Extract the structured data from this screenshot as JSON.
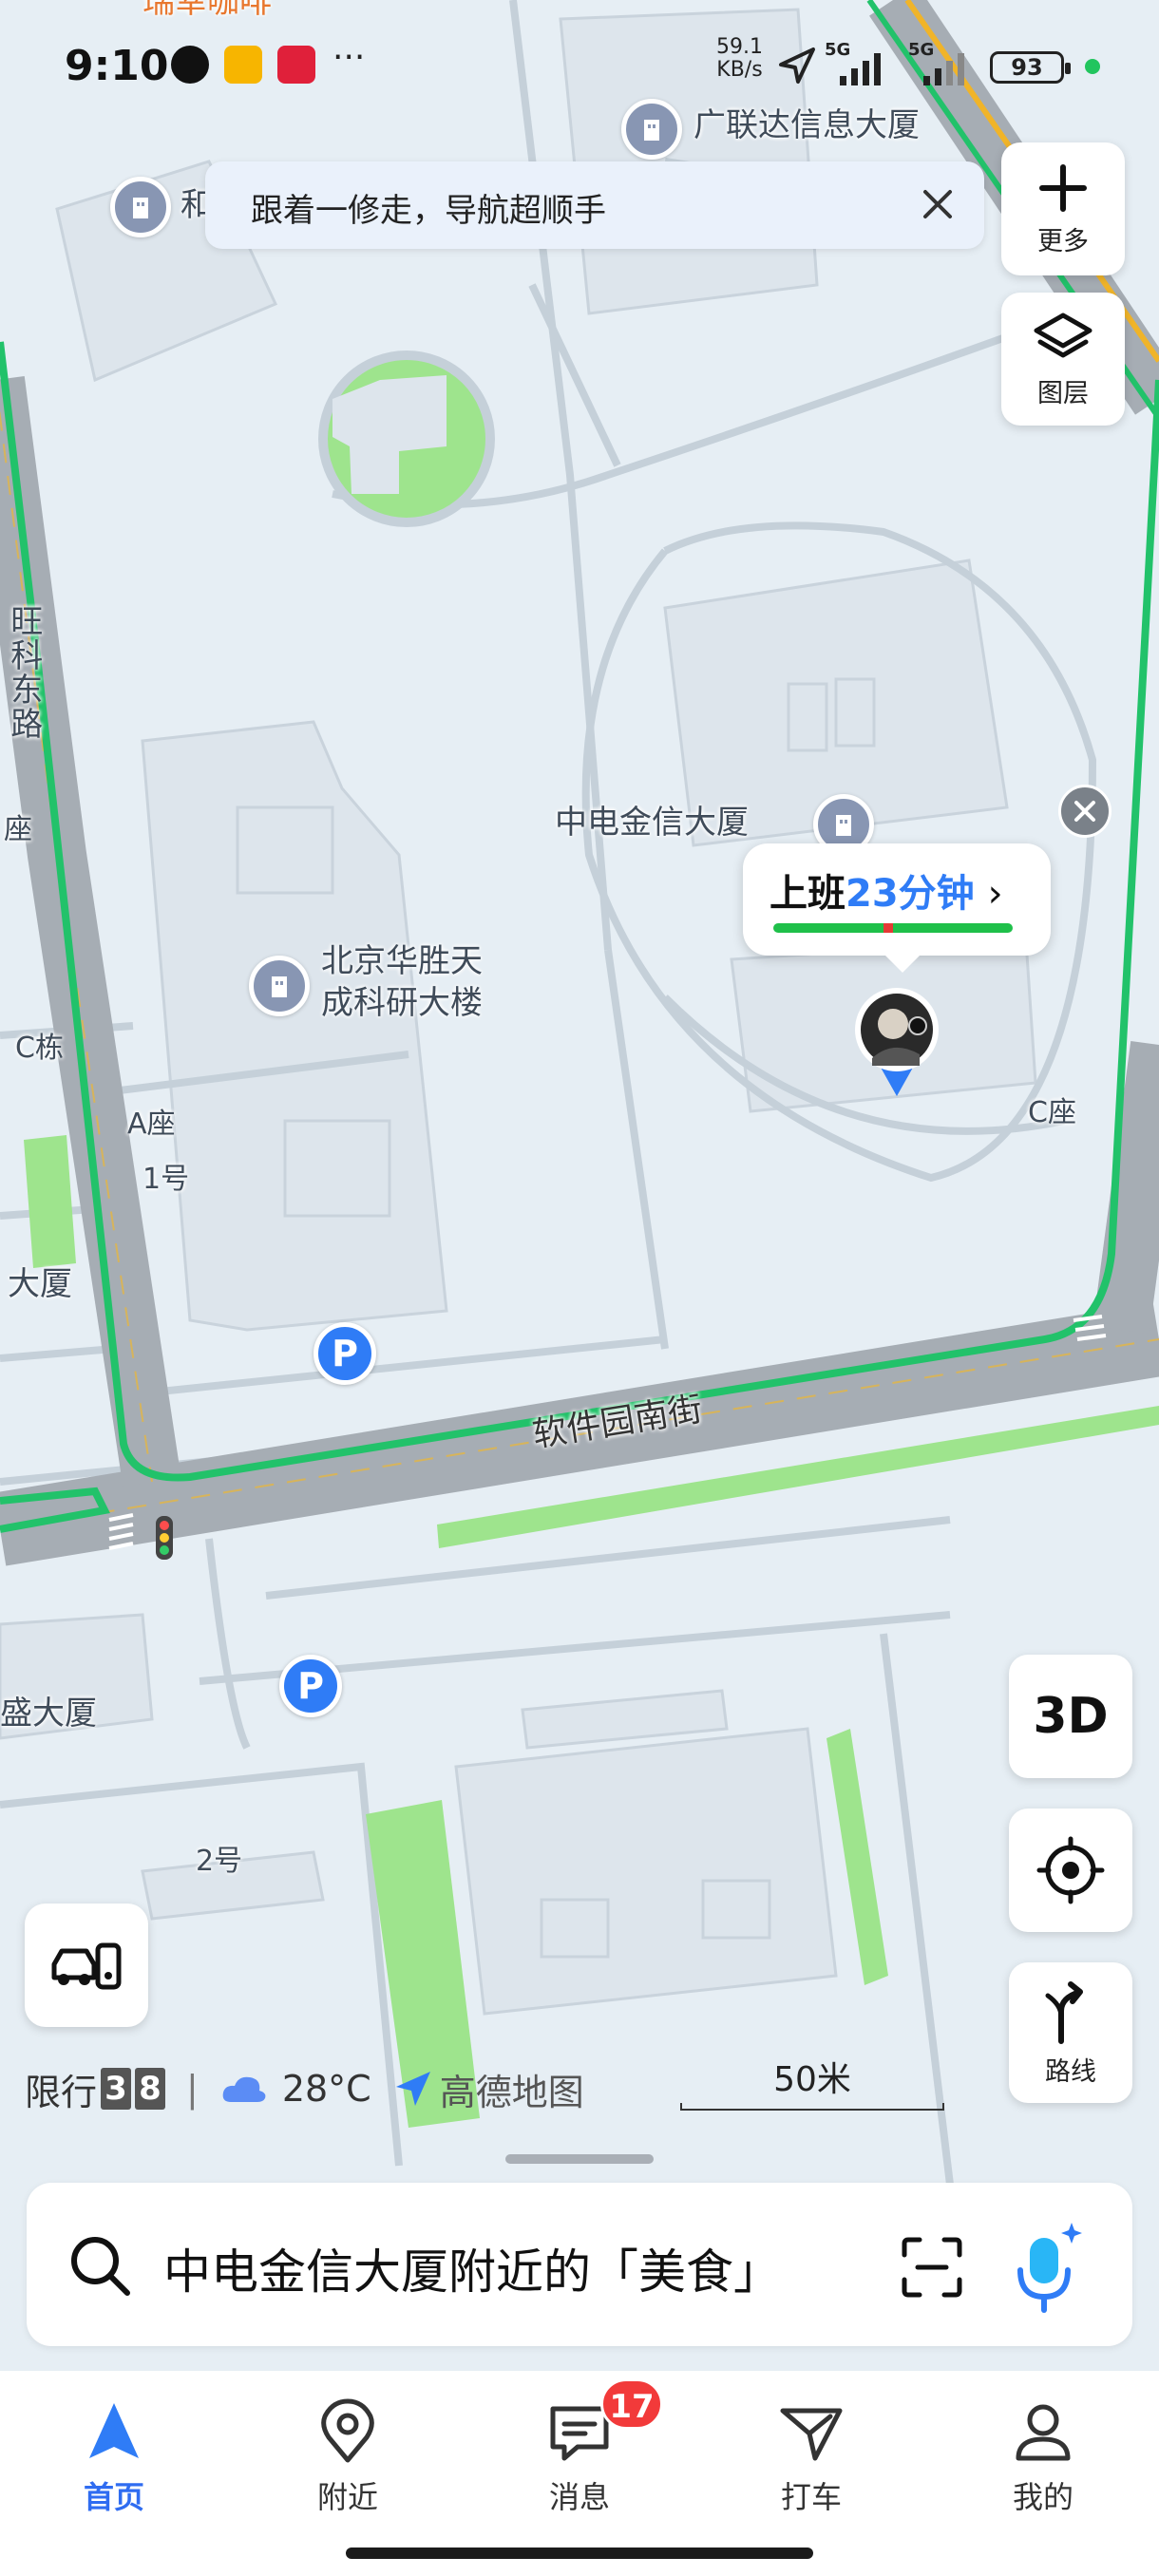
{
  "status_bar": {
    "time": "9:10",
    "net_speed": "59.1",
    "net_speed_unit": "KB/s",
    "signal1": "5G",
    "signal2": "5G",
    "battery": "93"
  },
  "banner": {
    "text": "跟着一修走，导航超顺手"
  },
  "map": {
    "labels": {
      "guanglianda": "广联达信息大厦",
      "zhongdian": "中电金信大厦",
      "huasheng_1": "北京华胜天",
      "huasheng_2": "成科研大楼",
      "wangkedonglu": "旺科东路",
      "c_dong": "C栋",
      "a_zuo": "A座",
      "yi_hao": "1号",
      "zuo": "座",
      "dasha_left": "大厦",
      "c_zuo": "C座",
      "sheng_dasha": "盛大厦",
      "er_hao": "2号",
      "he": "和",
      "ruanjian": "软件园南街",
      "top_partial": "瑞幸咖啡"
    },
    "parking_label": "P"
  },
  "right_controls": {
    "more": "更多",
    "layers": "图层",
    "three_d": "3D",
    "route": "路线"
  },
  "commute": {
    "prefix": "上班",
    "duration": "23分钟",
    "chevron": "›"
  },
  "info_bar": {
    "restrict_label": "限行",
    "plate1": "3",
    "plate2": "8",
    "separator": "|",
    "temperature": "28°C",
    "brand": "高德地图"
  },
  "scale": {
    "text": "50米"
  },
  "search": {
    "placeholder": "中电金信大厦附近的「美食」"
  },
  "tabs": [
    {
      "label": "首页"
    },
    {
      "label": "附近"
    },
    {
      "label": "消息"
    },
    {
      "label": "打车"
    },
    {
      "label": "我的"
    }
  ],
  "badges": {
    "messages": "17"
  },
  "colors": {
    "accent": "#2f7cf6",
    "route_green": "#1fc04a",
    "road": "#a6adb4",
    "park": "#9ee48d"
  },
  "icons": [
    "plus-icon",
    "layers-icon",
    "locate-icon",
    "route-icon",
    "search-icon",
    "scan-icon",
    "mic-icon",
    "car-traffic-icon",
    "cloud-icon",
    "amap-logo-icon",
    "close-icon",
    "building-icon",
    "parking-icon",
    "user-avatar-marker"
  ]
}
